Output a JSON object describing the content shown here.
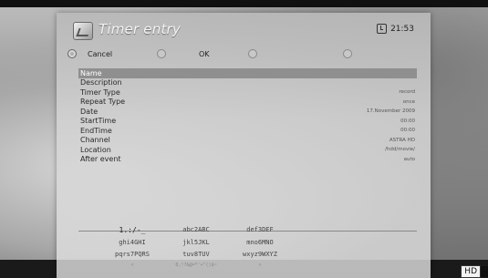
{
  "header": {
    "title": "Timer entry",
    "time": "21:53"
  },
  "buttons": [
    {
      "label": "Cancel",
      "color": "red"
    },
    {
      "label": "OK",
      "color": "green"
    },
    {
      "label": "",
      "color": "yellow"
    },
    {
      "label": "",
      "color": "blue"
    }
  ],
  "rows": [
    {
      "label": "Name",
      "value": ""
    },
    {
      "label": "Description",
      "value": ""
    },
    {
      "label": "Timer Type",
      "value": "record"
    },
    {
      "label": "Repeat Type",
      "value": "once"
    },
    {
      "label": "Date",
      "value": "17.November 2009"
    },
    {
      "label": "StartTime",
      "value": "00:00"
    },
    {
      "label": "EndTime",
      "value": "00:00"
    },
    {
      "label": "Channel",
      "value": "ASTRA HD"
    },
    {
      "label": "Location",
      "value": "/hdd/movie/"
    },
    {
      "label": "After event",
      "value": "auto"
    }
  ],
  "keypad": [
    "1.:/-_",
    "abc2ABC",
    "def3DEF",
    "ghi4GHI",
    "jkl5JKL",
    "mno6MNO",
    "pqrs7PQRS",
    "tuv8TUV",
    "wxyz9WXYZ",
    "<",
    "0,!?&@=*'+\"()$~",
    ">"
  ],
  "badge": {
    "hd": "HD"
  }
}
